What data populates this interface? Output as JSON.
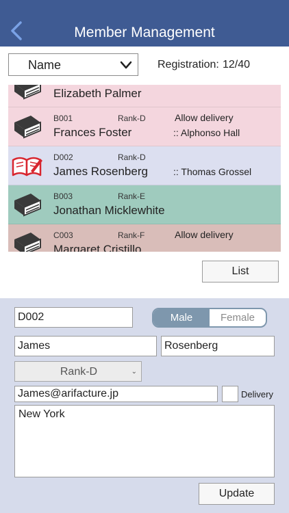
{
  "header": {
    "title": "Member Management",
    "back_icon": "chevron-left-icon"
  },
  "filter": {
    "sort_value": "Name",
    "registration_label": "Registration:",
    "registration_count": "12/40"
  },
  "members": [
    {
      "code": "",
      "rank": "",
      "delivery": "",
      "name": "Elizabeth Palmer",
      "assoc": "",
      "icon": "closed-book-icon",
      "color": "#f4d6de"
    },
    {
      "code": "B001",
      "rank": "Rank-D",
      "delivery": "Allow delivery",
      "name": "Frances Foster",
      "assoc": ":: Alphonso Hall",
      "icon": "closed-book-icon",
      "color": "#f4d6de"
    },
    {
      "code": "D002",
      "rank": "Rank-D",
      "delivery": "",
      "name": "James Rosenberg",
      "assoc": ":: Thomas Grossel",
      "icon": "open-book-red-icon",
      "color": "#dcdff0"
    },
    {
      "code": "B003",
      "rank": "Rank-E",
      "delivery": "",
      "name": "Jonathan Micklewhite",
      "assoc": "",
      "icon": "closed-book-icon",
      "color": "#9fcbbe"
    },
    {
      "code": "C003",
      "rank": "Rank-F",
      "delivery": "Allow delivery",
      "name": "Margaret Cristillo",
      "assoc": "",
      "icon": "closed-book-icon",
      "color": "#d9bdb9"
    }
  ],
  "list_button": "List",
  "form": {
    "code": "D002",
    "gender_male": "Male",
    "gender_female": "Female",
    "first_name": "James",
    "last_name": "Rosenberg",
    "rank": "Rank-D",
    "email": "James@arifacture.jp",
    "delivery_label": "Delivery",
    "address": "New York",
    "update_button": "Update"
  }
}
